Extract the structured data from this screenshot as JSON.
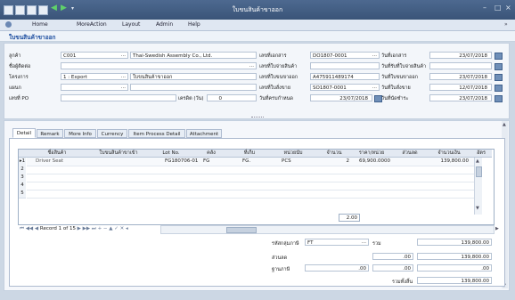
{
  "window": {
    "title": "ใบขนสินค้าขาออก"
  },
  "menu": [
    "Home",
    "MoreAction",
    "Layout",
    "Admin",
    "Help"
  ],
  "form_title": "ใบขนสินค้าขาออก",
  "header": {
    "customer_label": "ลูกค้า",
    "customer_code": "C001",
    "customer_name": "Thai-Swedish Assembly Co., Ltd.",
    "contact_label": "ชื่อผู้ติดต่อ",
    "project_label": "โครงการ",
    "project_value": "1 : Export",
    "project_desc": "ใบขนสินค้าขาออก",
    "dept_label": "แผนก",
    "po_label": "เลขที่ PO",
    "credit_label": "เครดิต (วัน)",
    "credit_value": "0",
    "docno_label": "เลขที่เอกสาร",
    "docno_value": "DO1807-0001",
    "issue_no_label": "เลขที่ใบจ่ายสินค้า",
    "exportno_label": "เลขที่ใบขนขาออก",
    "exportno_value": "A475911489174",
    "orderno_label": "เลขที่ใบสั่งขาย",
    "orderno_value": "SO1807-0001",
    "duedate_label": "วันที่ครบกำหนด",
    "duedate_value": "23/07/2018",
    "docdate_label": "วันที่เอกสาร",
    "docdate_value": "23/07/2018",
    "issuedate_label": "วันที่รับที่ใบจ่ายสินค้า",
    "exportdate_label": "วันที่ใบขนขาออก",
    "exportdate_value": "23/07/2018",
    "orderdate_label": "วันที่ใบสั่งขาย",
    "orderdate_value": "12/07/2018",
    "paydate_label": "วันที่นัดชำระ",
    "paydate_value": "23/07/2018"
  },
  "tabs": [
    "Detail",
    "Remark",
    "More Info",
    "Currency",
    "Item Process Detail",
    "Attachment"
  ],
  "grid": {
    "columns": [
      "ชื่อสินค้า",
      "ใบขนสินค้าขาเข้า",
      "Lot No.",
      "คลัง",
      "ที่เก็บ",
      "หน่วยนับ",
      "จำนวน",
      "ราคา/หน่วย",
      "ส่วนลด",
      "จำนวนเงิน",
      "อัตร"
    ],
    "rows": [
      {
        "no": "1",
        "name": "Driver Seat",
        "lot": "FG180706-01",
        "wh": "FG",
        "loc": "FG.",
        "unit": "PCS",
        "qty": "2",
        "price": "69,900.0000",
        "amount": "139,800.00"
      },
      {
        "no": "2"
      },
      {
        "no": "3"
      },
      {
        "no": "4"
      },
      {
        "no": "5"
      }
    ],
    "qty_total": "2.00",
    "record_text": "Record 1 of 15"
  },
  "summary": {
    "tax_code_label": "รหัสกลุ่มภาษี",
    "tax_code_value": "FT",
    "total_label": "รวม",
    "total_value": "139,800.00",
    "discount_label": "ส่วนลด",
    "discount_value": ".00",
    "discount_after": "139,800.00",
    "base_label": "ฐานภาษี",
    "base_value": ".00",
    "vat_value": ".00",
    "vat_amount": ".00",
    "grand_label": "รวมทั้งสิ้น",
    "grand_value": "139,800.00"
  }
}
